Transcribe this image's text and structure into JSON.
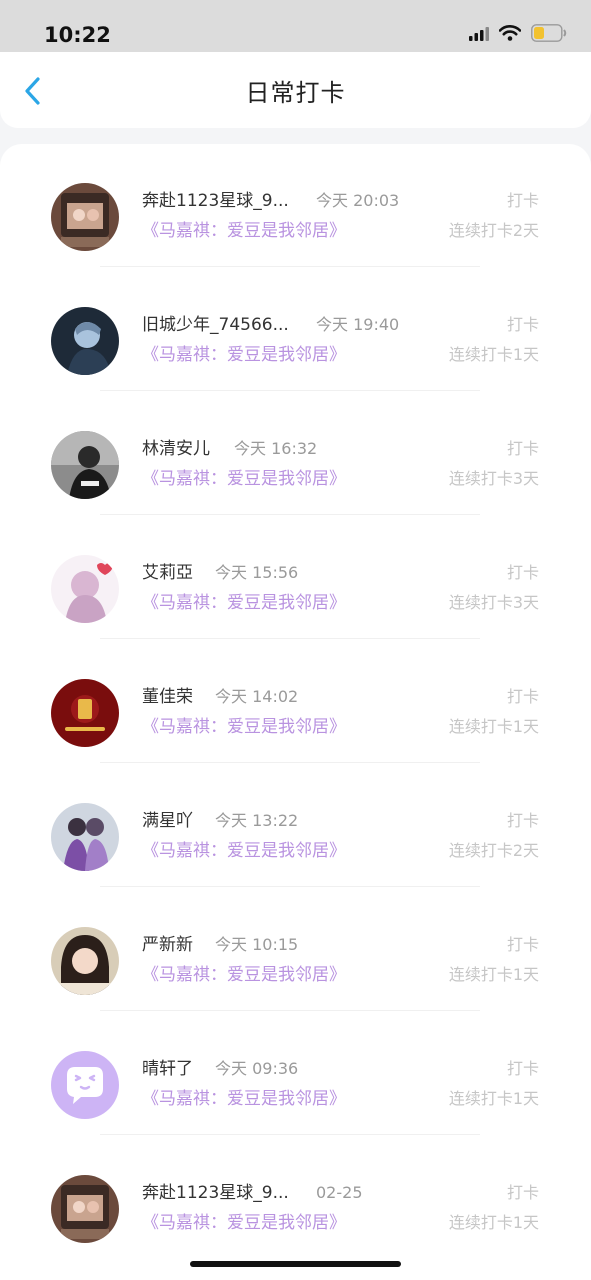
{
  "status_bar": {
    "time": "10:22",
    "icons": [
      "signal-icon",
      "wifi-icon",
      "battery-icon"
    ]
  },
  "nav": {
    "title": "日常打卡",
    "back_icon": "chevron-left-icon",
    "accent_color": "#2ba6e6"
  },
  "colors": {
    "book_title": "#b993e0",
    "meta_text": "#9a9a9a",
    "action_text": "#c6c6c6"
  },
  "list": [
    {
      "name": "奔赴1123星球_9...",
      "time": "今天 20:03",
      "book": "《马嘉祺：爱豆是我邻居》",
      "action": "打卡",
      "streak": "连续打卡2天",
      "avatar": "photo-avatar-icon"
    },
    {
      "name": "旧城少年_74566...",
      "time": "今天 19:40",
      "book": "《马嘉祺：爱豆是我邻居》",
      "action": "打卡",
      "streak": "连续打卡1天",
      "avatar": "photo-avatar-icon"
    },
    {
      "name": "林清安儿",
      "time": "今天 16:32",
      "book": "《马嘉祺：爱豆是我邻居》",
      "action": "打卡",
      "streak": "连续打卡3天",
      "avatar": "photo-avatar-icon"
    },
    {
      "name": "艾莉亞",
      "time": "今天 15:56",
      "book": "《马嘉祺：爱豆是我邻居》",
      "action": "打卡",
      "streak": "连续打卡3天",
      "avatar": "photo-avatar-icon"
    },
    {
      "name": "董佳荣",
      "time": "今天 14:02",
      "book": "《马嘉祺：爱豆是我邻居》",
      "action": "打卡",
      "streak": "连续打卡1天",
      "avatar": "photo-avatar-icon"
    },
    {
      "name": "满星吖",
      "time": "今天 13:22",
      "book": "《马嘉祺：爱豆是我邻居》",
      "action": "打卡",
      "streak": "连续打卡2天",
      "avatar": "photo-avatar-icon"
    },
    {
      "name": "严新新",
      "time": "今天 10:15",
      "book": "《马嘉祺：爱豆是我邻居》",
      "action": "打卡",
      "streak": "连续打卡1天",
      "avatar": "photo-avatar-icon"
    },
    {
      "name": "晴轩了",
      "time": "今天 09:36",
      "book": "《马嘉祺：爱豆是我邻居》",
      "action": "打卡",
      "streak": "连续打卡1天",
      "avatar": "default-chat-avatar-icon"
    },
    {
      "name": "奔赴1123星球_9...",
      "time": "02-25",
      "book": "《马嘉祺：爱豆是我邻居》",
      "action": "打卡",
      "streak": "连续打卡1天",
      "avatar": "photo-avatar-icon"
    }
  ]
}
